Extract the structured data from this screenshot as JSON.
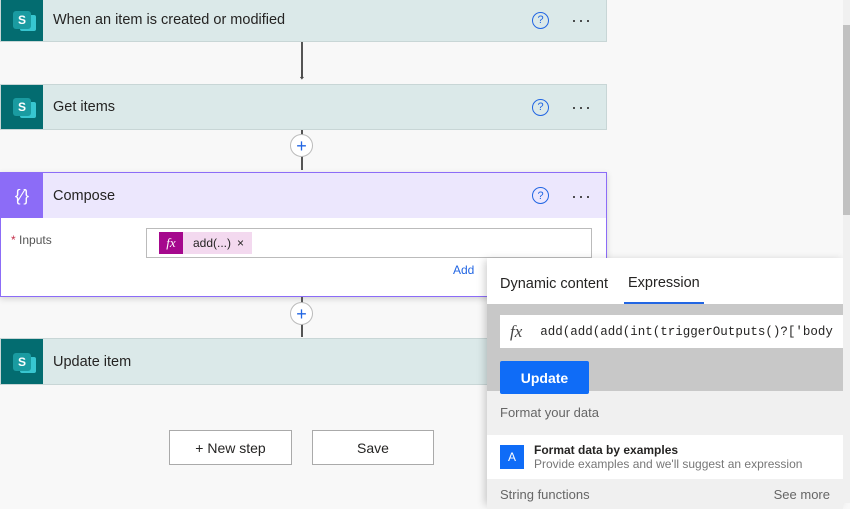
{
  "steps": [
    {
      "title": "When an item is created or modified"
    },
    {
      "title": "Get items"
    },
    {
      "title": "Compose"
    },
    {
      "title": "Update item"
    }
  ],
  "icons": {
    "sharepoint": "S",
    "help": "?",
    "more": "···",
    "plus": "+",
    "arrow": "↓",
    "compose": "{∕}"
  },
  "compose": {
    "inputs_label": "Inputs",
    "required": "*",
    "token_icon": "fx",
    "token_label": "add(...)",
    "token_remove": "×",
    "add_link": "Add"
  },
  "buttons": {
    "new_step": "+ New step",
    "save": "Save"
  },
  "popup": {
    "tabs": [
      "Dynamic content",
      "Expression"
    ],
    "active_tab": "Expression",
    "expression_icon": "fx",
    "expression": "add(add(add(int(triggerOutputs()?['body",
    "update": "Update",
    "section1": "Format your data",
    "item_title": "Format data by examples",
    "item_desc": "Provide examples and we'll suggest an expression",
    "section2": "String functions",
    "see_more": "See more"
  },
  "colors": {
    "accent": "#2266e3",
    "compose": "#8c6cf7",
    "sharepoint": "#036c70",
    "token": "#a5088d"
  }
}
